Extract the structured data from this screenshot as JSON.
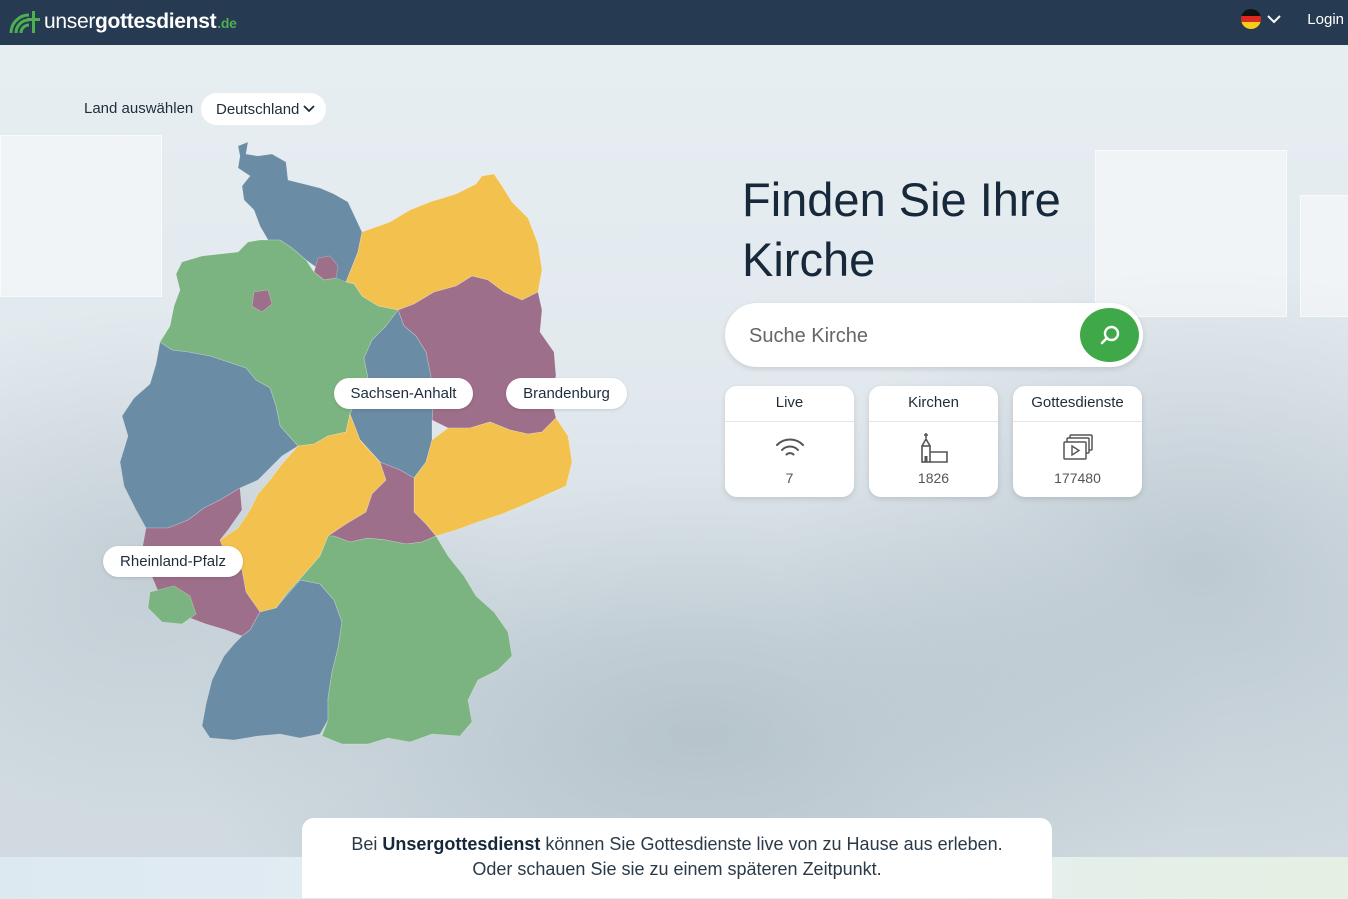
{
  "header": {
    "logo": {
      "prefix": "unser",
      "brand": "gottesdienst",
      "tld": ".de",
      "icon": "broadcast-cross-icon"
    },
    "language_flag": "germany-flag-icon",
    "login_label": "Login"
  },
  "country": {
    "label": "Land auswählen",
    "selected": "Deutschland"
  },
  "map": {
    "state_labels": [
      "Sachsen-Anhalt",
      "Brandenburg",
      "Rheinland-Pfalz"
    ],
    "colors": {
      "blue": "#6a8ca5",
      "green": "#7cb481",
      "yellow": "#f2c14e",
      "purple": "#9e6f8a"
    }
  },
  "hero": {
    "title_line1": "Finden Sie Ihre",
    "title_line2": "Kirche"
  },
  "search": {
    "placeholder": "Suche Kirche",
    "button_icon": "search-icon"
  },
  "stats": [
    {
      "label": "Live",
      "value": "7",
      "icon": "wifi-icon"
    },
    {
      "label": "Kirchen",
      "value": "1826",
      "icon": "church-icon"
    },
    {
      "label": "Gottesdienste",
      "value": "177480",
      "icon": "video-stack-icon"
    }
  ],
  "info": {
    "prefix": "Bei ",
    "brand": "Unsergottesdienst",
    "line1_rest": " können Sie Gottesdienste live von zu Hause aus erleben.",
    "line2": "Oder schauen Sie sie zu einem späteren Zeitpunkt."
  },
  "accent_color": "#3fa94a",
  "header_color": "#263a52"
}
